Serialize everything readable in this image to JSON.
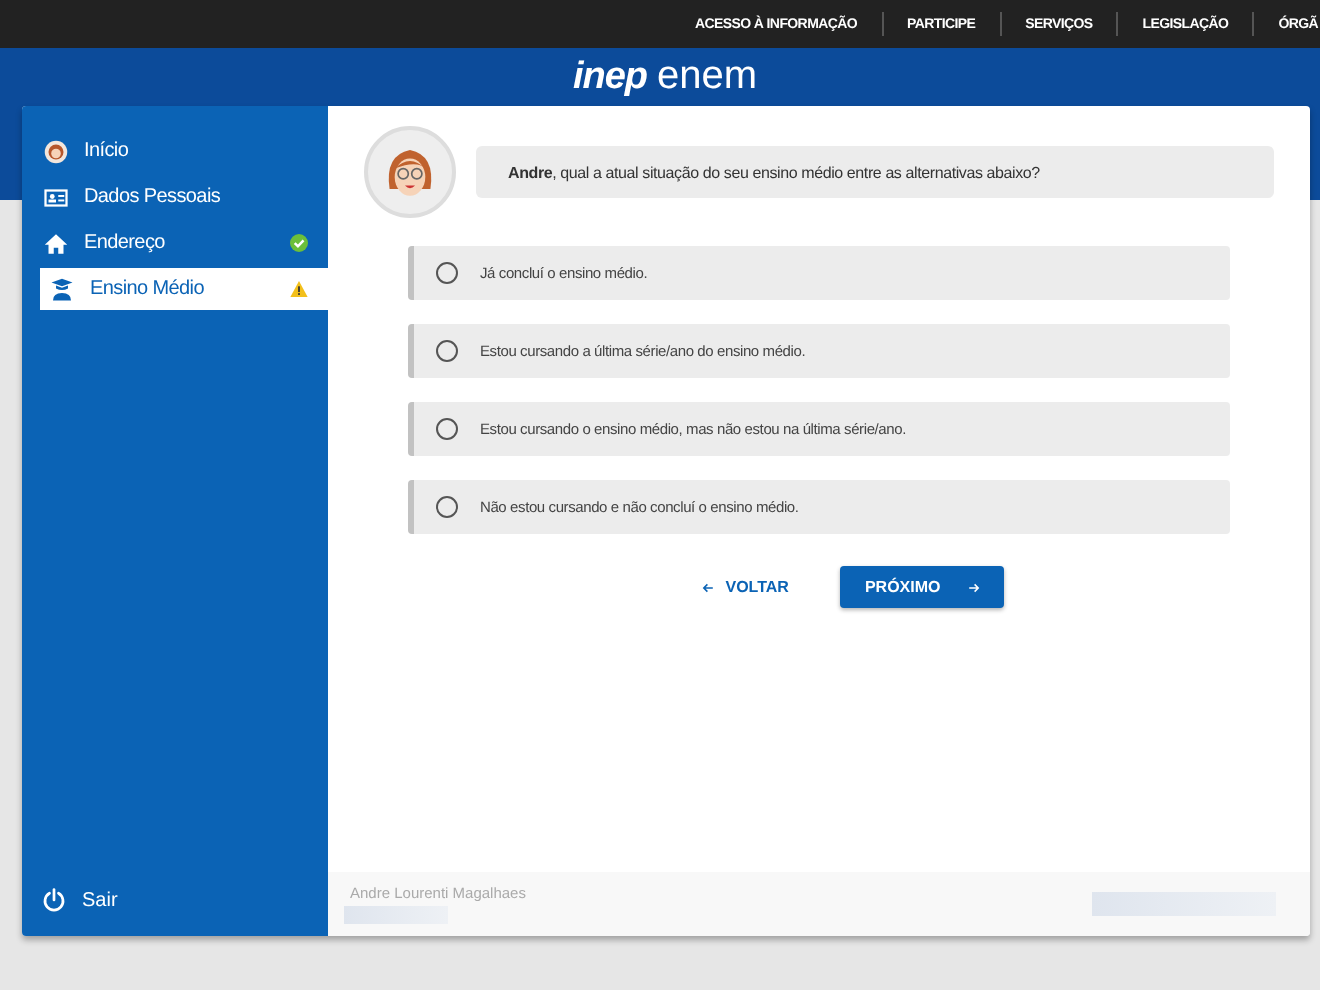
{
  "top_nav": [
    "ACESSO À INFORMAÇÃO",
    "PARTICIPE",
    "SERVIÇOS",
    "LEGISLAÇÃO",
    "ÓRGÃ"
  ],
  "logo": {
    "brand": "inep",
    "product": "enem"
  },
  "sidebar": {
    "items": [
      {
        "label": "Início",
        "kind": "avatar",
        "complete": false,
        "warning": false,
        "selected": false
      },
      {
        "label": "Dados Pessoais",
        "kind": "card",
        "complete": false,
        "warning": false,
        "selected": false
      },
      {
        "label": "Endereço",
        "kind": "home",
        "complete": true,
        "warning": false,
        "selected": false
      },
      {
        "label": "Ensino Médio",
        "kind": "student",
        "complete": false,
        "warning": true,
        "selected": true
      }
    ],
    "logout": "Sair"
  },
  "question": {
    "name": "Andre",
    "text": ", qual a atual situação do seu ensino médio entre as alternativas abaixo?"
  },
  "options": [
    {
      "label": "Já concluí o ensino médio.",
      "selected": false
    },
    {
      "label": "Estou cursando a última série/ano do ensino médio.",
      "selected": false
    },
    {
      "label": "Estou cursando o ensino médio, mas não estou na última série/ano.",
      "selected": false
    },
    {
      "label": "Não estou cursando e não concluí o ensino médio.",
      "selected": false
    }
  ],
  "buttons": {
    "back": "VOLTAR",
    "next": "PRÓXIMO"
  },
  "footer": {
    "user": "Andre Lourenti Magalhaes"
  }
}
